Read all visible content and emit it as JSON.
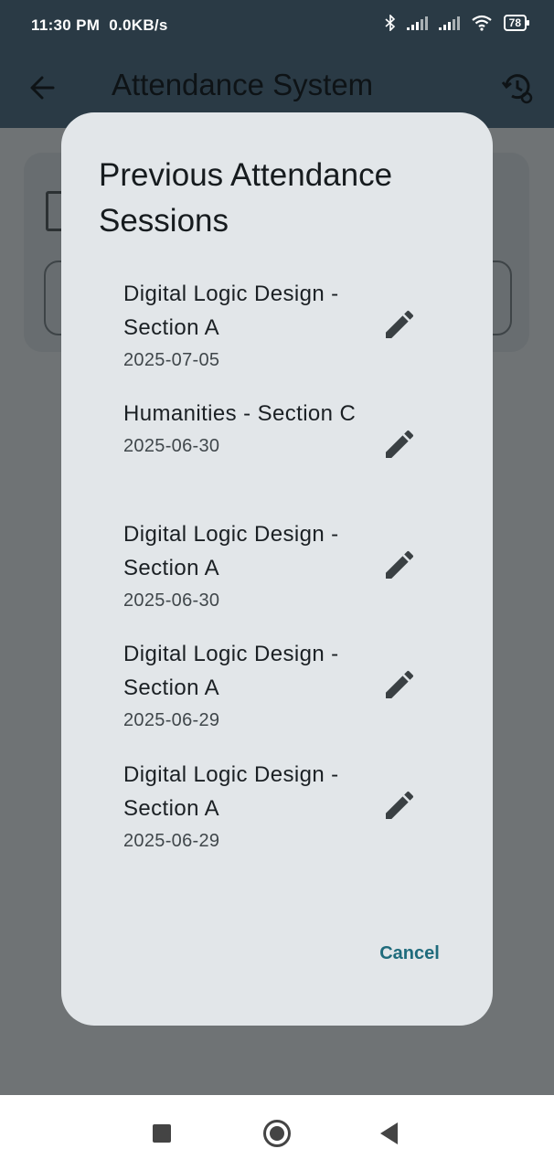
{
  "status_bar": {
    "time": "11:30 PM",
    "network_speed": "0.0KB/s",
    "battery": "78",
    "icons": [
      "bluetooth-icon",
      "signal-icon",
      "signal-icon",
      "wifi-icon",
      "battery-icon"
    ]
  },
  "app_bar": {
    "title": "Attendance System",
    "back_icon": "arrow-left-icon",
    "history_icon": "history-settings-icon"
  },
  "dialog": {
    "title": "Previous Attendance Sessions",
    "sessions": [
      {
        "name": "Digital Logic Design - Section A",
        "date": "2025-07-05"
      },
      {
        "name": "Humanities - Section C",
        "date": "2025-06-30"
      },
      {
        "name": "Digital Logic Design - Section A",
        "date": "2025-06-30"
      },
      {
        "name": "Digital Logic Design - Section A",
        "date": "2025-06-29"
      },
      {
        "name": "Digital Logic Design - Section A",
        "date": "2025-06-29"
      }
    ],
    "edit_icon": "pencil-icon",
    "cancel_label": "Cancel"
  },
  "colors": {
    "app_bar": "#2a3a45",
    "dialog_bg": "#e2e6e9",
    "scrim": "#6f7375",
    "accent": "#1f6b7c"
  }
}
